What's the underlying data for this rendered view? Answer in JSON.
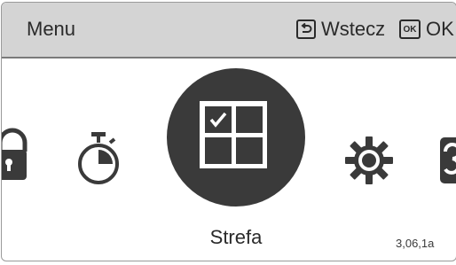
{
  "header": {
    "title": "Menu",
    "back_label": "Wstecz",
    "ok_key": "OK",
    "ok_label": "OK"
  },
  "menu": {
    "items": [
      {
        "icon": "lock-icon"
      },
      {
        "icon": "timer-icon"
      },
      {
        "icon": "zone-grid-icon",
        "selected": true
      },
      {
        "icon": "gear-icon"
      },
      {
        "icon": "service-icon"
      }
    ],
    "selected_label": "Strefa"
  },
  "footer": {
    "version": "3,06,1a"
  },
  "colors": {
    "header_bg": "#d4d4d4",
    "icon_dark": "#3a3a3a",
    "text": "#2a2a2a"
  }
}
